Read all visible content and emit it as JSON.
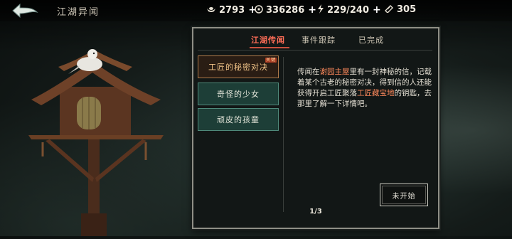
{
  "header": {
    "title": "江湖异闻",
    "back_icon": "back-arrow-icon",
    "resources": [
      {
        "icon": "ingot-icon",
        "value": "2793",
        "has_plus": true
      },
      {
        "icon": "coin-icon",
        "value": "336286",
        "has_plus": true
      },
      {
        "icon": "lightning-icon",
        "value": "229/240",
        "has_plus": true
      },
      {
        "icon": "ticket-icon",
        "value": "305",
        "has_plus": false
      }
    ],
    "plus_label": "+"
  },
  "panel": {
    "tabs": [
      {
        "label": "江湖传闻",
        "active": true
      },
      {
        "label": "事件跟踪",
        "active": false
      },
      {
        "label": "已完成",
        "active": false
      }
    ],
    "quests": [
      {
        "label": "工匠的秘密对决",
        "selected": true,
        "badge": "关键"
      },
      {
        "label": "奇怪的少女",
        "selected": false
      },
      {
        "label": "顽皮的孩童",
        "selected": false
      }
    ],
    "description": {
      "p1": "传闻在",
      "h1": "谢园主屋",
      "p2": "里有一封神秘的信，记载着某个古老的秘密对决，得到信的人还能获得开启工匠聚落",
      "h2": "工匠藏宝地",
      "p3": "的钥匙，去那里了解一下详情吧。"
    },
    "status_button": "未开始",
    "page": "1/3"
  },
  "colors": {
    "accent_red": "#ff6d57",
    "highlight": "#ff8a5c",
    "item_bg": "#1d3e37",
    "item_border": "#4f8a7b"
  }
}
